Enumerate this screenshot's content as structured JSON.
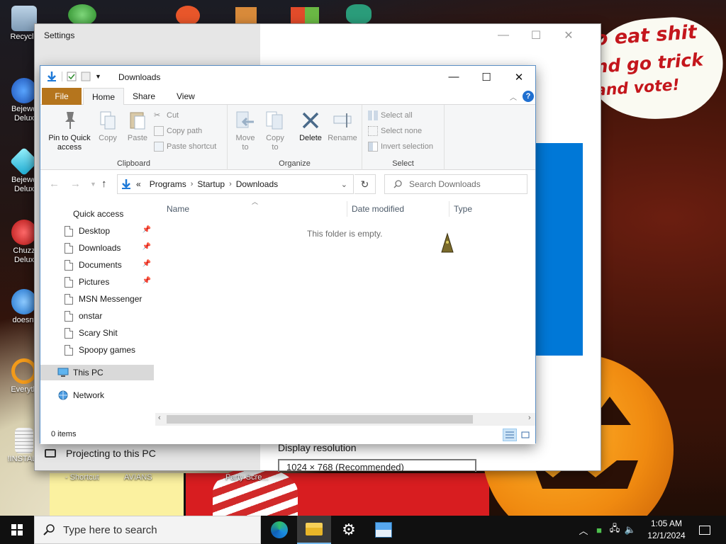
{
  "desktop": {
    "icons": [
      {
        "label": "Recycle",
        "color": "#8aa8c8"
      },
      {
        "label": "Bejewe Delux",
        "color": "#2a7bd6"
      },
      {
        "label": "Bejewe Delux",
        "color": "#2bd3e8"
      },
      {
        "label": "Chuzz Delux",
        "color": "#d62a2a"
      },
      {
        "label": "doesnt",
        "color": "#1f7ad8"
      },
      {
        "label": "Everyth",
        "color": "#f29a1a"
      },
      {
        "label": "!INSTALL",
        "color": "#d8d8d8"
      }
    ],
    "shortcut_labels": [
      "- Shortcut",
      "AVIANS",
      "Party Scre..."
    ],
    "wallpaper_text": [
      "o eat shit",
      "nd go trick",
      "and vote!"
    ]
  },
  "settings": {
    "title": "Settings",
    "projecting_label": "Projecting to this PC",
    "display_resolution_label": "Display resolution",
    "resolution_value": "1024 × 768 (Recommended)",
    "accent": "#0078d7"
  },
  "explorer": {
    "title": "Downloads",
    "tabs": {
      "file": "File",
      "home": "Home",
      "share": "Share",
      "view": "View"
    },
    "ribbon": {
      "clipboard": {
        "label": "Clipboard",
        "pin": "Pin to Quick access",
        "copy": "Copy",
        "paste": "Paste",
        "cut": "Cut",
        "copy_path": "Copy path",
        "paste_shortcut": "Paste shortcut"
      },
      "organize": {
        "label": "Organize",
        "move_to": "Move to",
        "copy_to": "Copy to",
        "delete": "Delete",
        "rename": "Rename"
      },
      "select": {
        "label": "Select",
        "select_all": "Select all",
        "select_none": "Select none",
        "invert": "Invert selection"
      }
    },
    "address": {
      "prefix": "«",
      "crumbs": [
        "Programs",
        "Startup",
        "Downloads"
      ],
      "search_placeholder": "Search Downloads"
    },
    "nav": {
      "quick_access": "Quick access",
      "pinned": [
        "Desktop",
        "Downloads",
        "Documents",
        "Pictures"
      ],
      "others": [
        "MSN Messenger",
        "onstar",
        "Scary Shit",
        "Spoopy games"
      ],
      "this_pc": "This PC",
      "network": "Network"
    },
    "columns": {
      "name": "Name",
      "date_modified": "Date modified",
      "type": "Type"
    },
    "empty_message": "This folder is empty.",
    "status": "0 items"
  },
  "taskbar": {
    "search_placeholder": "Type here to search",
    "time": "1:05 AM",
    "date": "12/1/2024"
  }
}
